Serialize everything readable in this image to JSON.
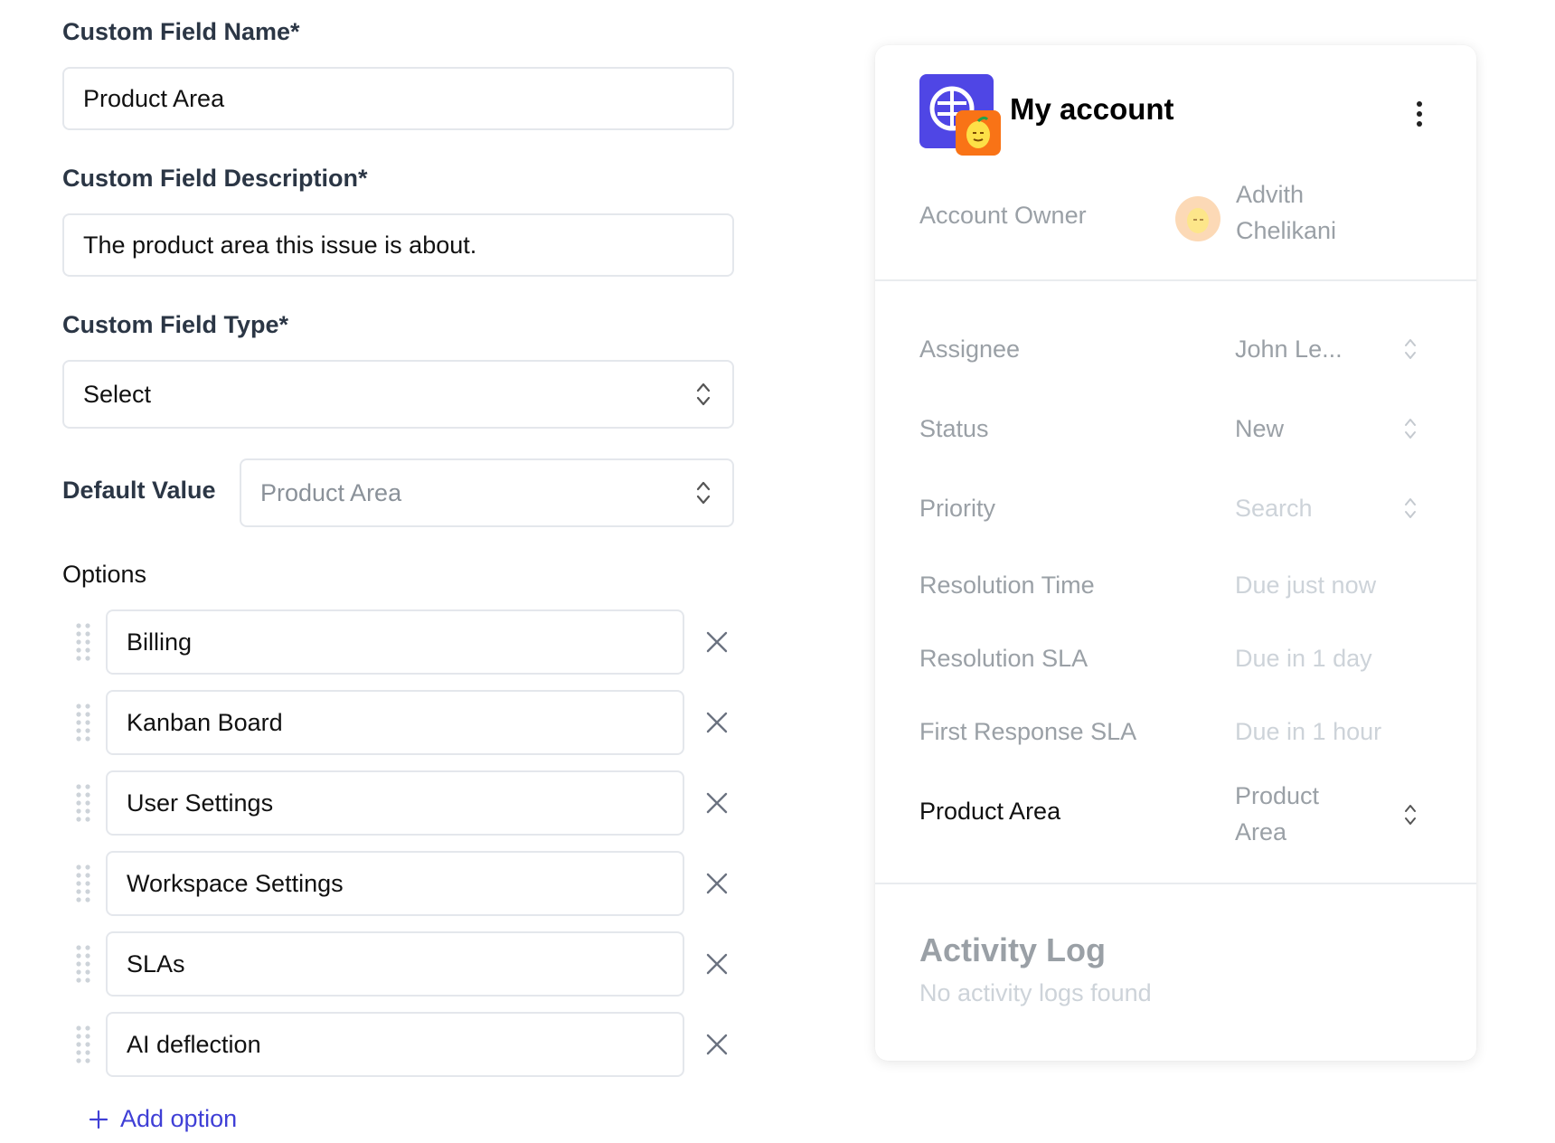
{
  "form": {
    "name_label": "Custom Field Name*",
    "name_value": "Product Area",
    "description_label": "Custom Field Description*",
    "description_value": "The product area this issue is about.",
    "type_label": "Custom Field Type*",
    "type_value": "Select",
    "default_label": "Default Value",
    "default_placeholder": "Product Area",
    "options_title": "Options",
    "options": [
      {
        "label": "Billing"
      },
      {
        "label": "Kanban Board"
      },
      {
        "label": "User Settings"
      },
      {
        "label": "Workspace Settings"
      },
      {
        "label": "SLAs"
      },
      {
        "label": "AI deflection"
      }
    ],
    "add_option_label": "Add option",
    "accent_color": "#3f3fd6"
  },
  "card": {
    "title": "My account",
    "owner_label": "Account Owner",
    "owner_name": "Advith Chelikani",
    "properties": [
      {
        "label": "Assignee",
        "value": "John Le..."
      },
      {
        "label": "Status",
        "value": "New"
      },
      {
        "label": "Priority",
        "value": "Search"
      },
      {
        "label": "Resolution Time",
        "value": "Due just now"
      },
      {
        "label": "Resolution SLA",
        "value": "Due in 1 day"
      },
      {
        "label": "First Response SLA",
        "value": "Due in 1 hour"
      },
      {
        "label": "Product Area",
        "value": "Product Area"
      }
    ],
    "activity_title": "Activity Log",
    "activity_empty": "No activity logs found",
    "logo_color": "#4f46e5",
    "badge_color": "#f97316"
  },
  "icons": {
    "select_chevron": "chevron-up-down-icon",
    "remove": "close-icon",
    "drag": "drag-handle-icon",
    "add": "plus-icon",
    "menu": "more-vertical-icon"
  }
}
